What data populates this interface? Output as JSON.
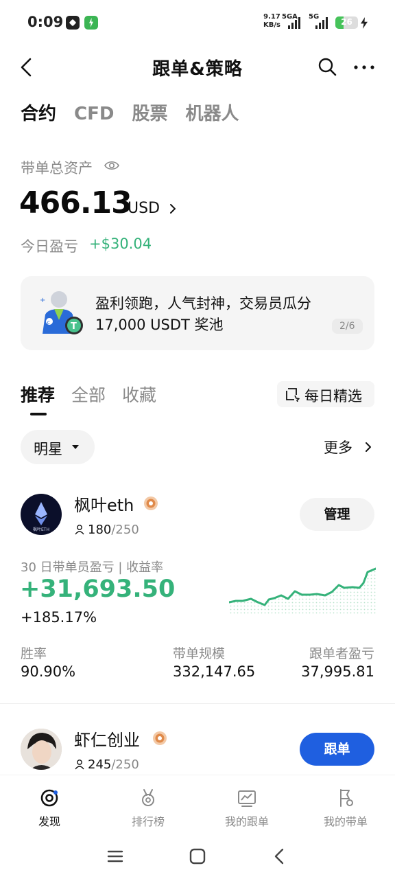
{
  "status_bar": {
    "time": "0:09",
    "net_speed": "9.17",
    "net_unit": "KB/s",
    "sim1": "5GA",
    "sim2": "5G",
    "battery": "26",
    "battery_level": 0.26
  },
  "header": {
    "title": "跟单&策略",
    "back_icon": "chevron-left-icon",
    "search_icon": "search-icon",
    "more_icon": "more-dots-icon"
  },
  "category_tabs": [
    {
      "label": "合约",
      "active": true
    },
    {
      "label": "CFD",
      "active": false
    },
    {
      "label": "股票",
      "active": false
    },
    {
      "label": "机器人",
      "active": false
    }
  ],
  "assets": {
    "label": "带单总资产",
    "value": "466.13",
    "unit": "USD",
    "today_label": "今日盈亏",
    "today_value": "+$30.04"
  },
  "banner": {
    "line1": "盈利领跑，人气封神，交易员瓜分",
    "line2": "17,000 USDT 奖池",
    "page": "2/6"
  },
  "sub_tabs": [
    {
      "label": "推荐",
      "active": true
    },
    {
      "label": "全部",
      "active": false
    },
    {
      "label": "收藏",
      "active": false
    }
  ],
  "daily_pick": {
    "label": "每日精选"
  },
  "filter": {
    "selected": "明星",
    "more": "更多"
  },
  "traders": [
    {
      "name": "枫叶eth",
      "avatar_text": "枫叶ETH",
      "followers": "180",
      "capacity": "/250",
      "action": "管理",
      "pnl_label": "30 日带单员盈亏 | 收益率",
      "pnl_value": "+31,693.50",
      "rate": "+185.17%",
      "stats": [
        {
          "label": "胜率",
          "value": "90.90%"
        },
        {
          "label": "带单规模",
          "value": "332,147.65"
        },
        {
          "label": "跟单者盈亏",
          "value": "37,995.81"
        }
      ]
    },
    {
      "name": "虾仁创业",
      "followers": "245",
      "capacity": "/250",
      "action": "跟单"
    }
  ],
  "bottom_nav": [
    {
      "label": "发现",
      "icon": "discover-icon",
      "active": true
    },
    {
      "label": "排行榜",
      "icon": "medal-icon",
      "active": false
    },
    {
      "label": "我的跟单",
      "icon": "chart-icon",
      "active": false
    },
    {
      "label": "我的带单",
      "icon": "flag-icon",
      "active": false
    }
  ],
  "colors": {
    "positive": "#35b27a",
    "primary_button": "#1f5fe0",
    "text": "#111111",
    "muted": "#8a8a8a"
  }
}
